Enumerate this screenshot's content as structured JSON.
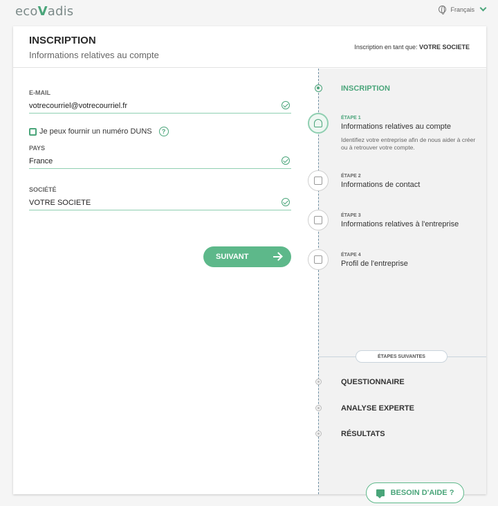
{
  "brand": {
    "logo_text_a": "eco",
    "logo_text_v": "V",
    "logo_text_b": "adis"
  },
  "language": {
    "current": "Français"
  },
  "header": {
    "title": "INSCRIPTION",
    "subtitle": "Informations relatives au compte",
    "registering_as_label": "Inscription en tant que:",
    "registering_as_value": "VOTRE SOCIETE"
  },
  "form": {
    "email": {
      "label": "E-MAIL",
      "value": "votrecourriel@votrecourriel.fr"
    },
    "duns": {
      "label": "Je peux fournir un numéro DUNS",
      "help": "?"
    },
    "country": {
      "label": "PAYS",
      "value": "France"
    },
    "company": {
      "label": "SOCIÉTÉ",
      "value": "VOTRE SOCIETE"
    },
    "next_button": "SUIVANT"
  },
  "stepper": {
    "section_title": "INSCRIPTION",
    "steps": [
      {
        "tag": "ÉTAPE 1",
        "name": "Informations relatives au compte",
        "desc": "Identifiez votre entreprise afin de nous aider à créer ou à retrouver votre compte.",
        "icon": "user-icon"
      },
      {
        "tag": "ÉTAPE 2",
        "name": "Informations de contact",
        "icon": "contact-card-icon"
      },
      {
        "tag": "ÉTAPE 3",
        "name": "Informations relatives à l'entreprise",
        "icon": "company-info-icon"
      },
      {
        "tag": "ÉTAPE 4",
        "name": "Profil de l'entreprise",
        "icon": "building-icon"
      }
    ],
    "next_steps_label": "ÉTAPES SUIVANTES",
    "next_steps": [
      "QUESTIONNAIRE",
      "ANALYSE EXPERTE",
      "RÉSULTATS"
    ],
    "help_button": "BESOIN D'AIDE ?"
  },
  "colors": {
    "accent": "#4aa57a",
    "button": "#5db88a",
    "underline": "#8fcfb1"
  }
}
